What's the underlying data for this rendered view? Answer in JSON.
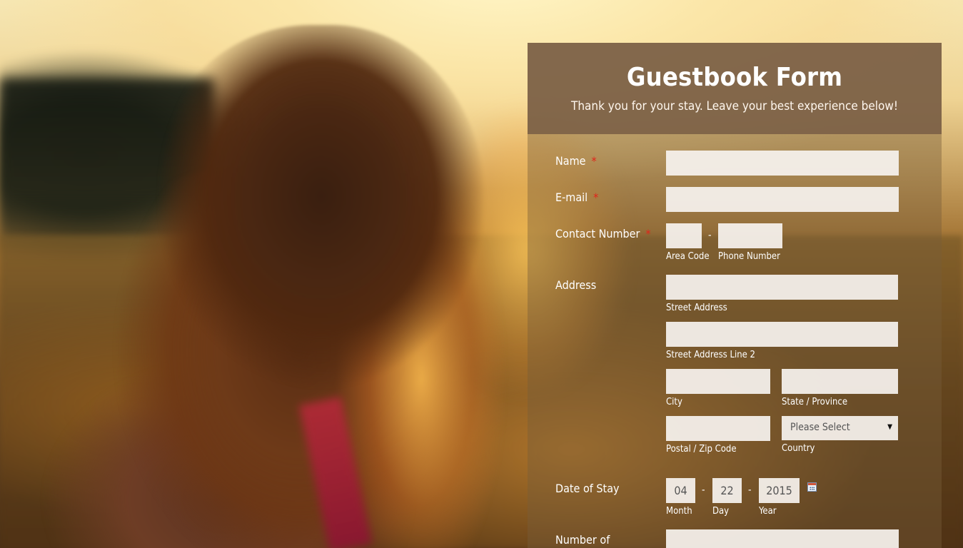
{
  "form": {
    "title": "Guestbook Form",
    "subtitle": "Thank you for your stay. Leave your best experience below!",
    "required_mark": "*"
  },
  "fields": {
    "name": {
      "label": "Name",
      "value": ""
    },
    "email": {
      "label": "E-mail",
      "value": ""
    },
    "contact": {
      "label": "Contact Number",
      "separator": "-",
      "area_code_sublabel": "Area Code",
      "phone_sublabel": "Phone Number",
      "area_code_value": "",
      "phone_value": ""
    },
    "address": {
      "label": "Address",
      "street_sublabel": "Street Address",
      "street2_sublabel": "Street Address Line 2",
      "city_sublabel": "City",
      "state_sublabel": "State / Province",
      "postal_sublabel": "Postal / Zip Code",
      "country_sublabel": "Country",
      "country_selected": "Please Select",
      "country_arrow": "▼"
    },
    "date_of_stay": {
      "label": "Date of Stay",
      "month": "04",
      "day": "22",
      "year": "2015",
      "separator": "-",
      "month_sublabel": "Month",
      "day_sublabel": "Day",
      "year_sublabel": "Year",
      "icon": "calendar-icon"
    },
    "number_of": {
      "label": "Number of"
    }
  },
  "colors": {
    "required": "#e2231a",
    "header_bg": "#7a5e46",
    "input_bg": "#f6f2ee"
  }
}
